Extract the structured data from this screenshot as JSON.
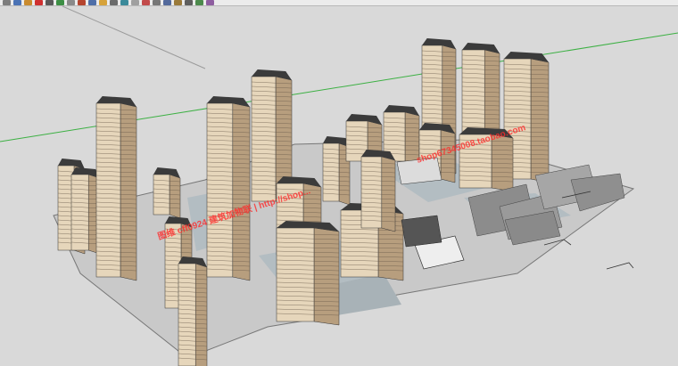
{
  "toolbar": {
    "buttons": [
      "select-tool-icon",
      "eraser-icon",
      "paint-bucket-icon",
      "rectangle-tool-icon",
      "line-tool-icon",
      "push-pull-icon",
      "move-tool-icon",
      "rotate-tool-icon",
      "orbit-icon",
      "pan-icon",
      "zoom-icon",
      "zoom-extents-icon",
      "tape-measure-icon",
      "text-tool-icon",
      "axes-icon",
      "section-plane-icon",
      "paint-icon",
      "walk-icon",
      "look-around-icon",
      "position-camera-icon"
    ],
    "colors": [
      "#7d7d7d",
      "#4b73b5",
      "#c98b2f",
      "#cf3030",
      "#5a5a5a",
      "#3d8f45",
      "#8a8a8a",
      "#b5452f",
      "#4f6fa8",
      "#d6a23a",
      "#6b6b6b",
      "#3b8a9a",
      "#a0a0a0",
      "#c24a4a",
      "#777777",
      "#536a9c",
      "#9a7a3a",
      "#5e5e5e",
      "#4c8a4c",
      "#8e5ea0"
    ]
  },
  "viewport": {
    "watermark_left": "图维 cff0924 建筑加物联 | http://shop...",
    "watermark_right": "shop67345008.taobao.com"
  },
  "scene": {
    "axis_green": "#3cb043",
    "axis_red": "#d33",
    "ground": "#cfcfcf",
    "road": "#b9c3c8",
    "tower_body": "#e6d6bb",
    "tower_shadow": "#b79e7e",
    "tower_roof": "#3b3b3b",
    "lowrise": "#9a9a9a"
  }
}
